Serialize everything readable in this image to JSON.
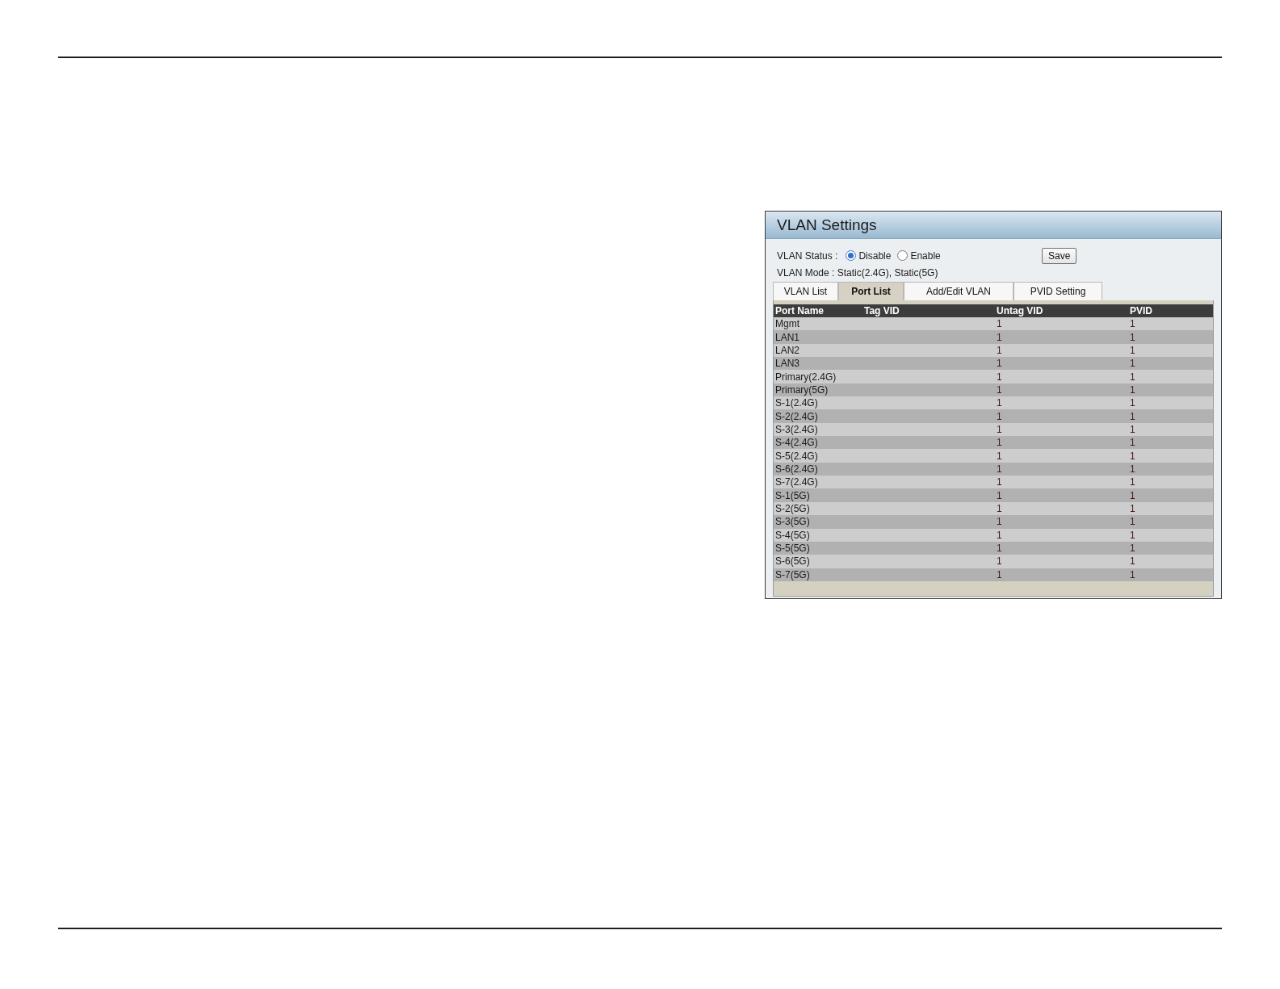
{
  "panel": {
    "title": "VLAN Settings",
    "vlan_status": {
      "label": "VLAN Status :",
      "options": [
        {
          "label": "Disable",
          "selected": true
        },
        {
          "label": "Enable",
          "selected": false
        }
      ]
    },
    "save_button": "Save",
    "vlan_mode": "VLAN Mode : Static(2.4G), Static(5G)",
    "tabs": [
      {
        "label": "VLAN List",
        "selected": false
      },
      {
        "label": "Port List",
        "selected": true
      },
      {
        "label": "Add/Edit VLAN",
        "selected": false
      },
      {
        "label": "PVID Setting",
        "selected": false
      }
    ],
    "table": {
      "columns": [
        "Port Name",
        "Tag VID",
        "Untag VID",
        "PVID"
      ],
      "rows": [
        {
          "port_name": "Mgmt",
          "untag_vid": "1",
          "pvid": "1"
        },
        {
          "port_name": "LAN1",
          "untag_vid": "1",
          "pvid": "1"
        },
        {
          "port_name": "LAN2",
          "untag_vid": "1",
          "pvid": "1"
        },
        {
          "port_name": "LAN3",
          "untag_vid": "1",
          "pvid": "1"
        },
        {
          "port_name": "Primary(2.4G)",
          "untag_vid": "1",
          "pvid": "1"
        },
        {
          "port_name": "Primary(5G)",
          "untag_vid": "1",
          "pvid": "1"
        },
        {
          "port_name": "S-1(2.4G)",
          "untag_vid": "1",
          "pvid": "1"
        },
        {
          "port_name": "S-2(2.4G)",
          "untag_vid": "1",
          "pvid": "1"
        },
        {
          "port_name": "S-3(2.4G)",
          "untag_vid": "1",
          "pvid": "1"
        },
        {
          "port_name": "S-4(2.4G)",
          "untag_vid": "1",
          "pvid": "1"
        },
        {
          "port_name": "S-5(2.4G)",
          "untag_vid": "1",
          "pvid": "1"
        },
        {
          "port_name": "S-6(2.4G)",
          "untag_vid": "1",
          "pvid": "1"
        },
        {
          "port_name": "S-7(2.4G)",
          "untag_vid": "1",
          "pvid": "1"
        },
        {
          "port_name": "S-1(5G)",
          "untag_vid": "1",
          "pvid": "1"
        },
        {
          "port_name": "S-2(5G)",
          "untag_vid": "1",
          "pvid": "1"
        },
        {
          "port_name": "S-3(5G)",
          "untag_vid": "1",
          "pvid": "1"
        },
        {
          "port_name": "S-4(5G)",
          "untag_vid": "1",
          "pvid": "1"
        },
        {
          "port_name": "S-5(5G)",
          "untag_vid": "1",
          "pvid": "1"
        },
        {
          "port_name": "S-6(5G)",
          "untag_vid": "1",
          "pvid": "1"
        },
        {
          "port_name": "S-7(5G)",
          "untag_vid": "1",
          "pvid": "1"
        }
      ]
    }
  }
}
